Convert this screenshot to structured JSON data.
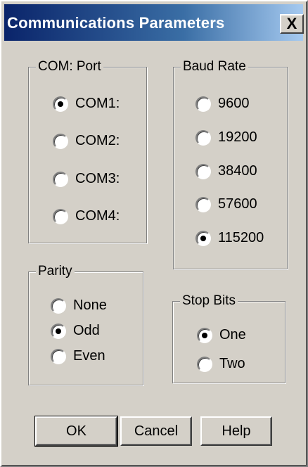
{
  "window": {
    "title": "Communications Parameters",
    "close_label": "X"
  },
  "com_port": {
    "label": "COM: Port",
    "options": [
      {
        "label": "COM1:",
        "checked": true
      },
      {
        "label": "COM2:",
        "checked": false
      },
      {
        "label": "COM3:",
        "checked": false
      },
      {
        "label": "COM4:",
        "checked": false
      }
    ]
  },
  "baud_rate": {
    "label": "Baud Rate",
    "options": [
      {
        "label": "9600",
        "checked": false
      },
      {
        "label": "19200",
        "checked": false
      },
      {
        "label": "38400",
        "checked": false
      },
      {
        "label": "57600",
        "checked": false
      },
      {
        "label": "115200",
        "checked": true
      }
    ]
  },
  "parity": {
    "label": "Parity",
    "options": [
      {
        "label": "None",
        "checked": false
      },
      {
        "label": "Odd",
        "checked": true
      },
      {
        "label": "Even",
        "checked": false
      }
    ]
  },
  "stop_bits": {
    "label": "Stop Bits",
    "options": [
      {
        "label": "One",
        "checked": true
      },
      {
        "label": "Two",
        "checked": false
      }
    ]
  },
  "buttons": {
    "ok": "OK",
    "cancel": "Cancel",
    "help": "Help"
  },
  "colors": {
    "face": "#d4d0c8",
    "title_start": "#0a246a",
    "title_end": "#a6caf0"
  }
}
